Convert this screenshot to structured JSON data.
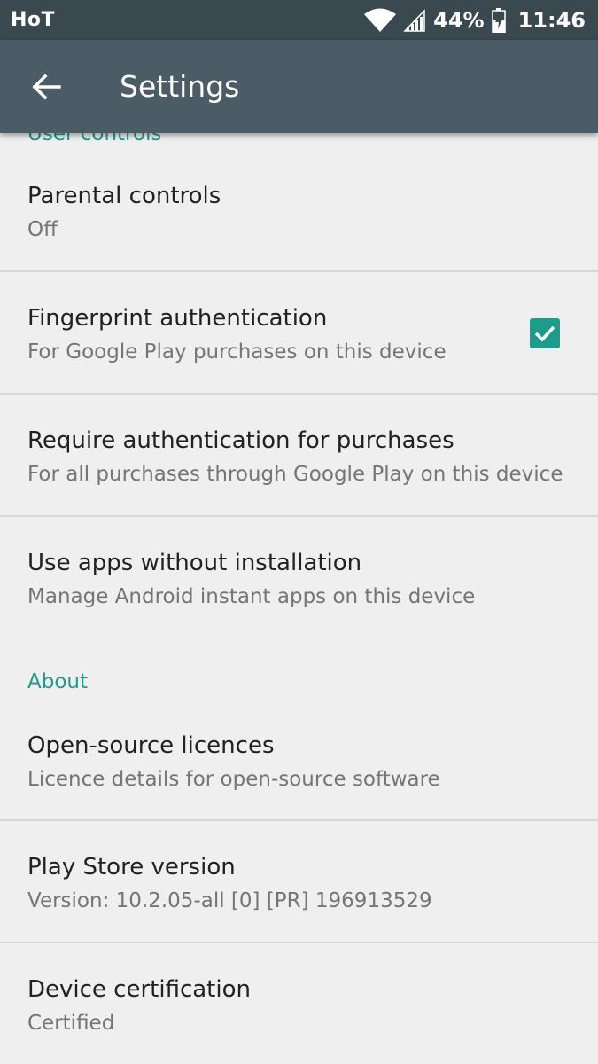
{
  "status_bar": {
    "carrier": "HoT",
    "battery_percent": "44%",
    "time": "11:46",
    "icons": [
      "wifi-icon",
      "signal-icon",
      "battery-charging-icon"
    ]
  },
  "toolbar": {
    "title": "Settings",
    "back_icon": "arrow-back-icon"
  },
  "sections": {
    "user_controls": {
      "header": "User controls"
    },
    "about": {
      "header": "About"
    }
  },
  "items": [
    {
      "title": "Parental controls",
      "summary": "Off"
    },
    {
      "title": "Fingerprint authentication",
      "summary": "For Google Play purchases on this device",
      "checked": true
    },
    {
      "title": "Require authentication for purchases",
      "summary": "For all purchases through Google Play on this device"
    },
    {
      "title": "Use apps without installation",
      "summary": "Manage Android instant apps on this device"
    },
    {
      "title": "Open-source licences",
      "summary": "Licence details for open-source software"
    },
    {
      "title": "Play Store version",
      "summary": "Version: 10.2.05-all [0] [PR] 196913529"
    },
    {
      "title": "Device certification",
      "summary": "Certified"
    }
  ],
  "colors": {
    "status_bar": "#3a4850",
    "toolbar": "#4b5c66",
    "accent": "#1e9b8a",
    "background": "#efefef"
  }
}
